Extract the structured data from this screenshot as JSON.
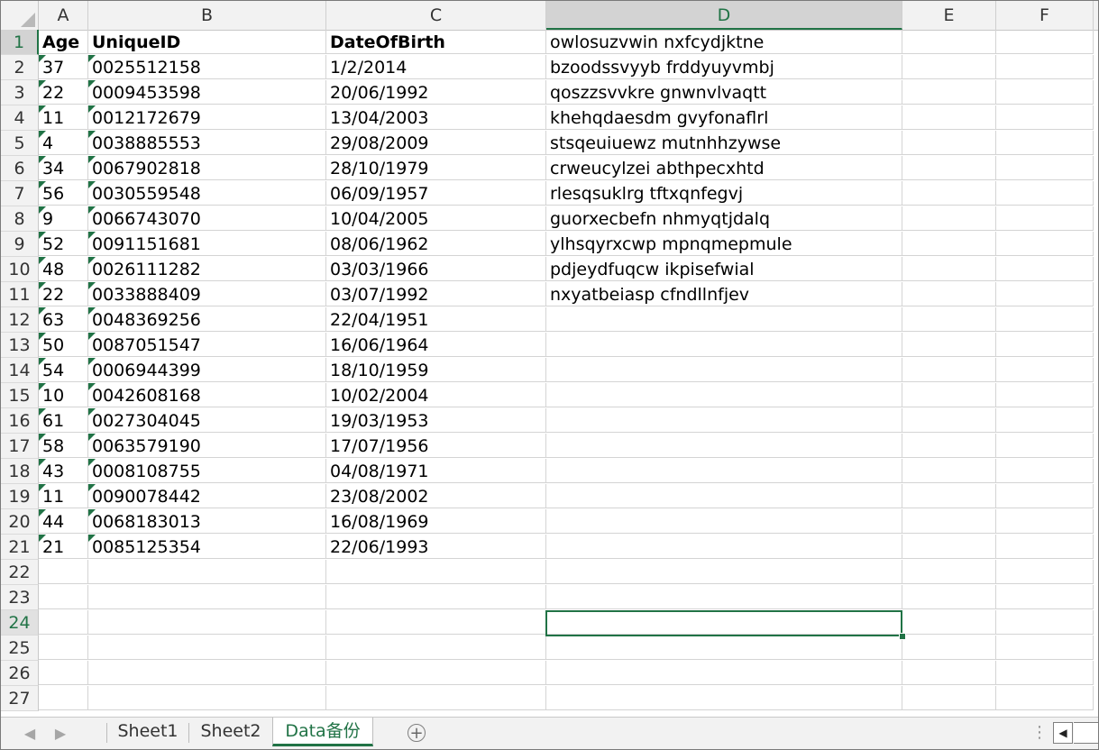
{
  "columns": [
    "A",
    "B",
    "C",
    "D",
    "E",
    "F"
  ],
  "selected_column": "D",
  "selected_row": "24",
  "header_row": {
    "age": "Age",
    "id": "UniqueID",
    "dob": "DateOfBirth",
    "text": "owlosuzvwin nxfcydjktne"
  },
  "rows": [
    {
      "n": "2",
      "age": "37",
      "id": "0025512158",
      "dob": "1/2/2014",
      "text": "bzoodssvyyb frddyuyvmbj"
    },
    {
      "n": "3",
      "age": "22",
      "id": "0009453598",
      "dob": "20/06/1992",
      "text": "qoszzsvvkre gnwnvlvaqtt"
    },
    {
      "n": "4",
      "age": "11",
      "id": "0012172679",
      "dob": "13/04/2003",
      "text": "khehqdaesdm gvyfonaflrl"
    },
    {
      "n": "5",
      "age": "4",
      "id": "0038885553",
      "dob": "29/08/2009",
      "text": "stsqeuiuewz mutnhhzywse"
    },
    {
      "n": "6",
      "age": "34",
      "id": "0067902818",
      "dob": "28/10/1979",
      "text": "crweucylzei abthpecxhtd"
    },
    {
      "n": "7",
      "age": "56",
      "id": "0030559548",
      "dob": "06/09/1957",
      "text": "rlesqsuklrg tftxqnfegvj"
    },
    {
      "n": "8",
      "age": "9",
      "id": "0066743070",
      "dob": "10/04/2005",
      "text": "guorxecbefn nhmyqtjdalq"
    },
    {
      "n": "9",
      "age": "52",
      "id": "0091151681",
      "dob": "08/06/1962",
      "text": "ylhsqyrxcwp mpnqmepmule"
    },
    {
      "n": "10",
      "age": "48",
      "id": "0026111282",
      "dob": "03/03/1966",
      "text": "pdjeydfuqcw ikpisefwial"
    },
    {
      "n": "11",
      "age": "22",
      "id": "0033888409",
      "dob": "03/07/1992",
      "text": "nxyatbeiasp cfndllnfjev"
    },
    {
      "n": "12",
      "age": "63",
      "id": "0048369256",
      "dob": "22/04/1951",
      "text": ""
    },
    {
      "n": "13",
      "age": "50",
      "id": "0087051547",
      "dob": "16/06/1964",
      "text": ""
    },
    {
      "n": "14",
      "age": "54",
      "id": "0006944399",
      "dob": "18/10/1959",
      "text": ""
    },
    {
      "n": "15",
      "age": "10",
      "id": "0042608168",
      "dob": "10/02/2004",
      "text": ""
    },
    {
      "n": "16",
      "age": "61",
      "id": "0027304045",
      "dob": "19/03/1953",
      "text": ""
    },
    {
      "n": "17",
      "age": "58",
      "id": "0063579190",
      "dob": "17/07/1956",
      "text": ""
    },
    {
      "n": "18",
      "age": "43",
      "id": "0008108755",
      "dob": "04/08/1971",
      "text": ""
    },
    {
      "n": "19",
      "age": "11",
      "id": "0090078442",
      "dob": "23/08/2002",
      "text": ""
    },
    {
      "n": "20",
      "age": "44",
      "id": "0068183013",
      "dob": "16/08/1969",
      "text": ""
    },
    {
      "n": "21",
      "age": "21",
      "id": "0085125354",
      "dob": "22/06/1993",
      "text": ""
    }
  ],
  "empty_rows": [
    "22",
    "23",
    "24",
    "25",
    "26",
    "27"
  ],
  "sheet_tabs": [
    {
      "label": "Sheet1",
      "active": false
    },
    {
      "label": "Sheet2",
      "active": false
    },
    {
      "label": "Data备份",
      "active": true
    }
  ],
  "tabbar": {
    "prev_icon": "◀",
    "next_icon": "▶",
    "add_label": "+",
    "dots": "⋮",
    "scroll_left": "◀"
  },
  "colors": {
    "accent": "#217346",
    "header_bg": "#f2f2f2",
    "gridline": "#d4d4d4"
  }
}
